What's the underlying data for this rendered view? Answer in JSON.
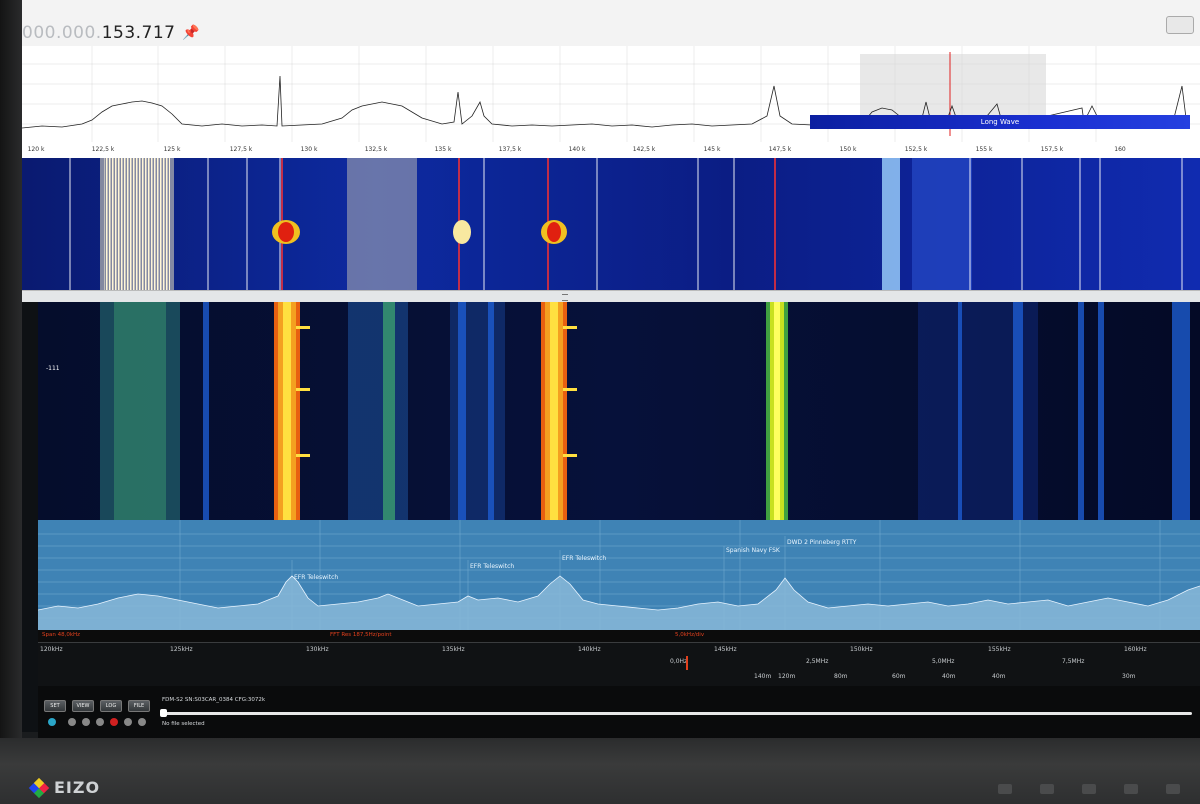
{
  "topbar": {
    "freq_prefix": "000.000.",
    "freq_value": "153.717",
    "pin_icon": "pin-icon"
  },
  "spectrum": {
    "band_label": "Long Wave",
    "axis_ticks": [
      "120 k",
      "122,5 k",
      "125 k",
      "127,5 k",
      "130 k",
      "132,5 k",
      "135 k",
      "137,5 k",
      "140 k",
      "142,5 k",
      "145 k",
      "147,5 k",
      "150 k",
      "152,5 k",
      "155 k",
      "157,5 k",
      "160"
    ]
  },
  "waterfall": {
    "db_label": "-111"
  },
  "analyzer": {
    "peaks": [
      {
        "label": "EFR Teleswitch"
      },
      {
        "label": "EFR Teleswitch"
      },
      {
        "label": "EFR Teleswitch"
      },
      {
        "label": "Spanish Navy FSK"
      },
      {
        "label": "DWD 2 Pinneberg RTTY"
      }
    ],
    "info_span": "Span 48,0kHz",
    "info_fft": "FFT Res  187,5Hz/point",
    "info_div": "5,0kHz/div",
    "scale_main": [
      "120kHz",
      "125kHz",
      "130kHz",
      "135kHz",
      "140kHz",
      "145kHz",
      "150kHz",
      "155kHz",
      "160kHz"
    ],
    "scale_first": "125kHz",
    "scale_mid": [
      "0,0Hz",
      "2,5MHz",
      "5,0MHz",
      "7,5MHz"
    ],
    "scale_bottom": [
      "140m",
      "120m",
      "80m",
      "60m",
      "40m",
      "40m",
      "30m"
    ]
  },
  "controls": {
    "buttons": [
      "SET",
      "VIEW",
      "LOG",
      "FILE"
    ],
    "device_line": "FDM-S2  SN:S03CAR_0384  CFG:3072k",
    "file_line": "No file selected"
  },
  "bezel": {
    "brand": "EIZO"
  }
}
